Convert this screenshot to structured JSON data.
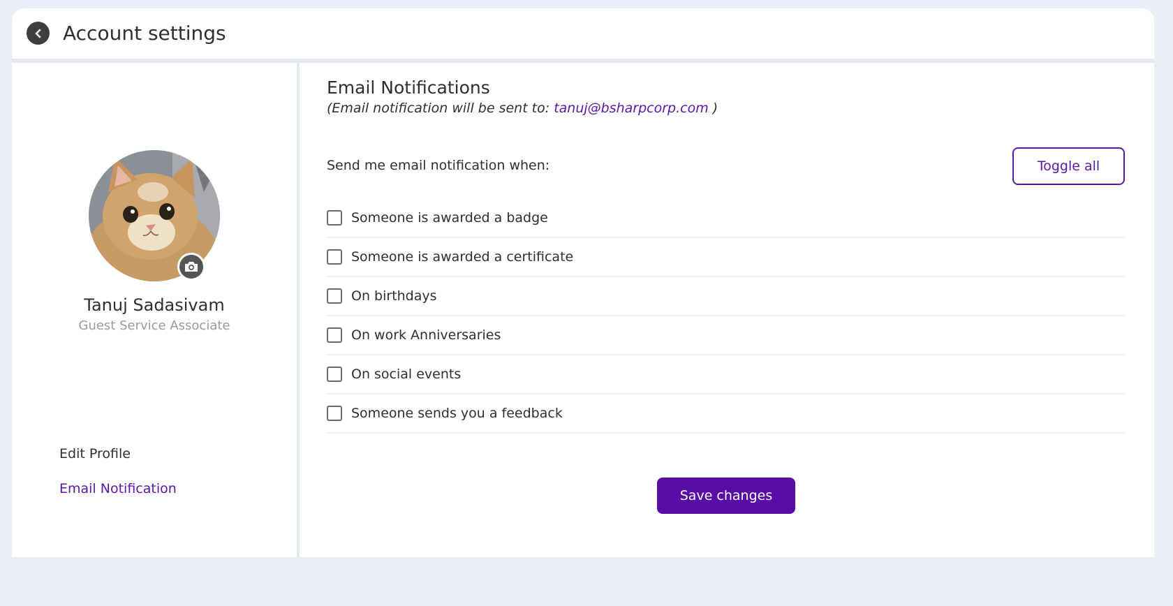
{
  "header": {
    "title": "Account settings"
  },
  "profile": {
    "name": "Tanuj Sadasivam",
    "role": "Guest Service Associate"
  },
  "sidebar": {
    "items": [
      {
        "label": "Edit Profile",
        "active": false
      },
      {
        "label": "Email Notification",
        "active": true
      }
    ]
  },
  "main": {
    "title": "Email Notifications",
    "subtitle_prefix": "(Email notification will be sent to: ",
    "email": "tanuj@bsharpcorp.com",
    "subtitle_suffix": " )",
    "prompt": "Send me email notification when:",
    "toggle_all_label": "Toggle all",
    "options": [
      {
        "label": "Someone is awarded a badge",
        "checked": false
      },
      {
        "label": "Someone is awarded a certificate",
        "checked": false
      },
      {
        "label": "On birthdays",
        "checked": false
      },
      {
        "label": "On work Anniversaries",
        "checked": false
      },
      {
        "label": "On social events",
        "checked": false
      },
      {
        "label": "Someone sends you a feedback",
        "checked": false
      }
    ],
    "save_label": "Save changes"
  },
  "colors": {
    "accent": "#5a16a8",
    "background": "#eaeef5"
  }
}
